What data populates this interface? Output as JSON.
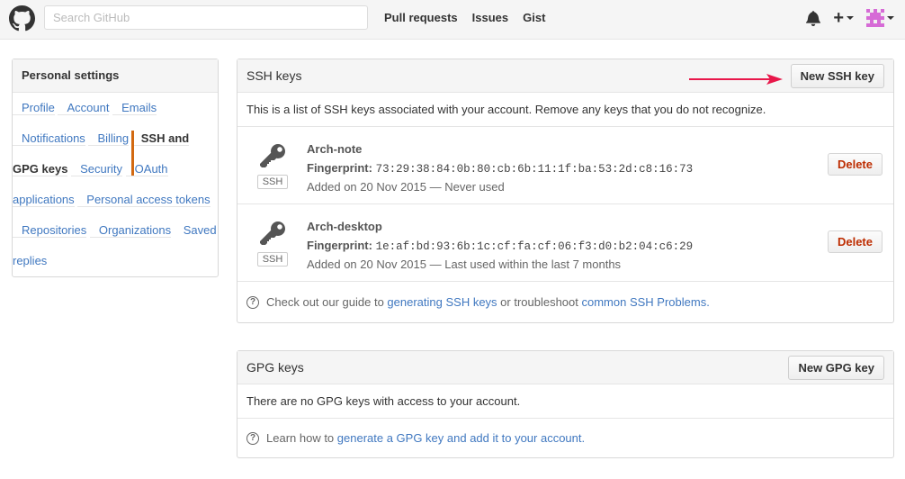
{
  "header": {
    "search_placeholder": "Search GitHub",
    "nav": [
      "Pull requests",
      "Issues",
      "Gist"
    ],
    "plus_label": "+"
  },
  "sidebar": {
    "title": "Personal settings",
    "items": [
      {
        "label": "Profile"
      },
      {
        "label": "Account"
      },
      {
        "label": "Emails"
      },
      {
        "label": "Notifications"
      },
      {
        "label": "Billing"
      },
      {
        "label": "SSH and GPG keys",
        "active": true
      },
      {
        "label": "Security"
      },
      {
        "label": "OAuth applications"
      },
      {
        "label": "Personal access tokens"
      },
      {
        "label": "Repositories"
      },
      {
        "label": "Organizations"
      },
      {
        "label": "Saved replies"
      }
    ]
  },
  "ssh": {
    "title": "SSH keys",
    "new_button": "New SSH key",
    "description": "This is a list of SSH keys associated with your account. Remove any keys that you do not recognize.",
    "keys": [
      {
        "name": "Arch-note",
        "fingerprint_label": "Fingerprint:",
        "fingerprint": "73:29:38:84:0b:80:cb:6b:11:1f:ba:53:2d:c8:16:73",
        "added": "Added on 20 Nov 2015 — Never used",
        "badge": "SSH",
        "delete": "Delete"
      },
      {
        "name": "Arch-desktop",
        "fingerprint_label": "Fingerprint:",
        "fingerprint": "1e:af:bd:93:6b:1c:cf:fa:cf:06:f3:d0:b2:04:c6:29",
        "added": "Added on 20 Nov 2015 — Last used within the last 7 months",
        "badge": "SSH",
        "delete": "Delete"
      }
    ],
    "help": {
      "prefix": "Check out our guide to ",
      "link1": "generating SSH keys",
      "middle": " or troubleshoot ",
      "link2": "common SSH Problems",
      "suffix": "."
    }
  },
  "gpg": {
    "title": "GPG keys",
    "new_button": "New GPG key",
    "empty": "There are no GPG keys with access to your account.",
    "help": {
      "prefix": "Learn how to ",
      "link": "generate a GPG key and add it to your account",
      "suffix": "."
    }
  },
  "colors": {
    "link": "#4078c0",
    "active_bar": "#d26911",
    "delete": "#bd2c00",
    "arrow": "#e8174a"
  },
  "icons": [
    "github-logo-icon",
    "bell-icon",
    "plus-icon",
    "avatar",
    "key-icon",
    "question-icon"
  ]
}
